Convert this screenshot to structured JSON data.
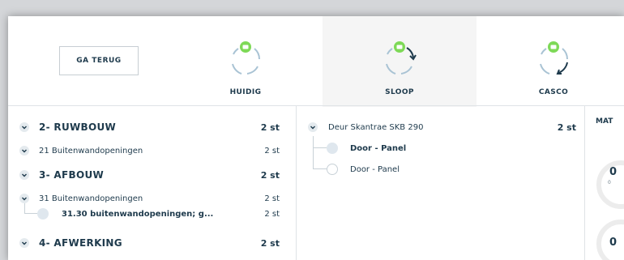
{
  "header": {
    "back_label": "GA TERUG",
    "phases": [
      {
        "label": "HUIDIG",
        "active": false
      },
      {
        "label": "SLOOP",
        "active": true
      },
      {
        "label": "CASCO",
        "active": false
      }
    ]
  },
  "tree": [
    {
      "label": "2- RUWBOUW",
      "qty": "2 st",
      "level": "group"
    },
    {
      "label": "21 Buitenwandopeningen",
      "qty": "2 st",
      "level": "sub"
    },
    {
      "label": "3- AFBOUW",
      "qty": "2 st",
      "level": "group"
    },
    {
      "label": "31 Buitenwandopeningen",
      "qty": "2 st",
      "level": "sub"
    },
    {
      "label": "31.30 buitenwandopeningen; g...",
      "qty": "2 st",
      "level": "leaf"
    },
    {
      "label": "4- AFWERKING",
      "qty": "2 st",
      "level": "group"
    }
  ],
  "middle": {
    "title": "Deur Skantrae SKB 290",
    "qty": "2 st",
    "items": [
      {
        "label": "Door - Panel",
        "selected": true
      },
      {
        "label": "Door - Panel",
        "selected": false
      }
    ]
  },
  "right": {
    "label": "MAT",
    "gauges": [
      {
        "value": "0",
        "sub": "0"
      },
      {
        "value": "0",
        "sub": ""
      }
    ]
  },
  "colors": {
    "accent_green": "#7ed957",
    "arrow_dark": "#1e3a4c",
    "arrow_light": "#a9c3d4"
  }
}
